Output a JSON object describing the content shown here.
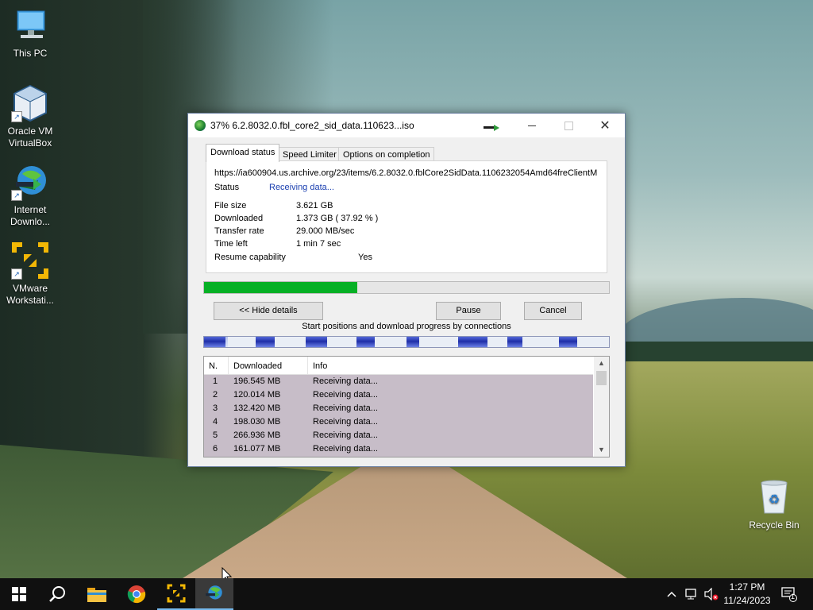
{
  "desktop": {
    "icons": [
      {
        "label": "This PC"
      },
      {
        "label": "Oracle VM VirtualBox"
      },
      {
        "label": "Internet Downlo..."
      },
      {
        "label": "VMware Workstati..."
      },
      {
        "label": "Recycle Bin"
      }
    ]
  },
  "window": {
    "title": "37% 6.2.8032.0.fbl_core2_sid_data.110623...iso",
    "controls": {
      "minimize": "minimize",
      "maximize": "maximize",
      "close": "✕"
    },
    "tabs": [
      {
        "label": "Download status",
        "active": true
      },
      {
        "label": "Speed Limiter",
        "active": false
      },
      {
        "label": "Options on completion",
        "active": false
      }
    ],
    "url": "https://ia600904.us.archive.org/23/items/6.2.8032.0.fblCore2SidData.1106232054Amd64freClientM",
    "status_label": "Status",
    "status_value": "Receiving data...",
    "info": [
      {
        "label": "File size",
        "value": "3.621  GB"
      },
      {
        "label": "Downloaded",
        "value": "1.373  GB  ( 37.92 % )"
      },
      {
        "label": "Transfer rate",
        "value": "29.000  MB/sec"
      },
      {
        "label": "Time left",
        "value": "1 min 7 sec"
      },
      {
        "label": "Resume capability",
        "value": "Yes"
      }
    ],
    "progress_fraction": 0.3792,
    "buttons": {
      "hide_details": "<< Hide details",
      "pause": "Pause",
      "cancel": "Cancel"
    },
    "connections_label": "Start positions and download progress by connections",
    "connections_table": {
      "columns": [
        "N.",
        "Downloaded",
        "Info"
      ],
      "rows": [
        {
          "n": "1",
          "downloaded": "196.545  MB",
          "info": "Receiving data..."
        },
        {
          "n": "2",
          "downloaded": "120.014  MB",
          "info": "Receiving data..."
        },
        {
          "n": "3",
          "downloaded": "132.420  MB",
          "info": "Receiving data..."
        },
        {
          "n": "4",
          "downloaded": "198.030  MB",
          "info": "Receiving data..."
        },
        {
          "n": "5",
          "downloaded": "266.936  MB",
          "info": "Receiving data..."
        },
        {
          "n": "6",
          "downloaded": "161.077  MB",
          "info": "Receiving data..."
        }
      ]
    }
  },
  "taskbar": {
    "items": [
      "start-icon",
      "search-icon",
      "file-explorer-icon",
      "chrome-icon",
      "vmware-icon",
      "idm-icon"
    ],
    "clock_time": "1:27 PM",
    "clock_date": "11/24/2023",
    "notification_count": "1"
  },
  "colors": {
    "progress": "#06b025",
    "status_text": "#1a3fb0",
    "taskbar": "#101010"
  }
}
